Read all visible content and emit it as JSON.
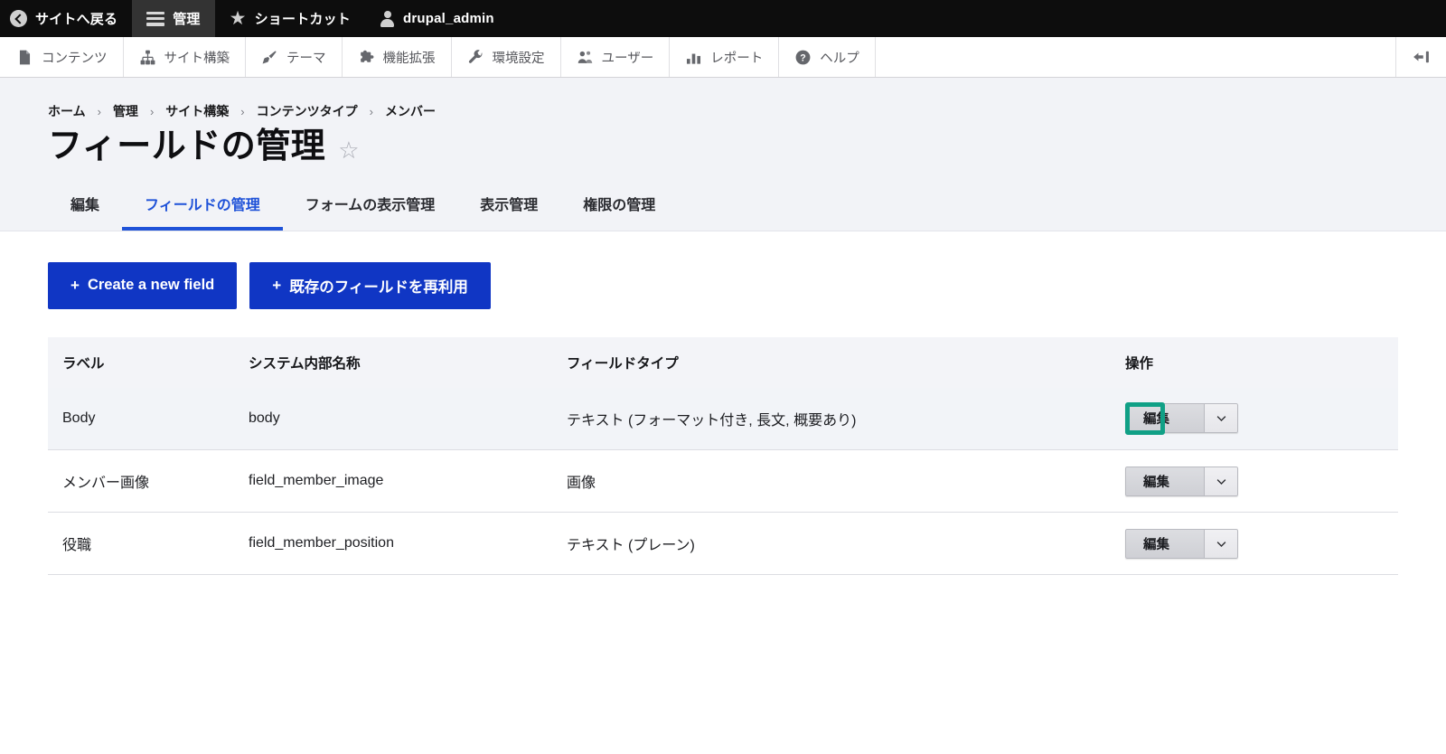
{
  "admin_bar": {
    "items": [
      {
        "label": "サイトへ戻る",
        "icon": "back-circle-icon",
        "active": false
      },
      {
        "label": "管理",
        "icon": "hamburger-menu-icon",
        "active": true
      },
      {
        "label": "ショートカット",
        "icon": "star-icon",
        "active": false
      },
      {
        "label": "drupal_admin",
        "icon": "user-person-icon",
        "active": false
      }
    ]
  },
  "menu_bar": {
    "items": [
      {
        "label": "コンテンツ",
        "icon": "document-icon"
      },
      {
        "label": "サイト構築",
        "icon": "sitemap-icon"
      },
      {
        "label": "テーマ",
        "icon": "paintbrush-icon"
      },
      {
        "label": "機能拡張",
        "icon": "puzzle-piece-icon"
      },
      {
        "label": "環境設定",
        "icon": "wrench-icon"
      },
      {
        "label": "ユーザー",
        "icon": "users-icon"
      },
      {
        "label": "レポート",
        "icon": "bar-chart-icon"
      },
      {
        "label": "ヘルプ",
        "icon": "question-mark-icon"
      }
    ],
    "toggle_icon": "collapse-toolbar-icon"
  },
  "breadcrumb": [
    {
      "label": "ホーム"
    },
    {
      "label": "管理"
    },
    {
      "label": "サイト構築"
    },
    {
      "label": "コンテンツタイプ"
    },
    {
      "label": "メンバー"
    }
  ],
  "breadcrumb_separator": "›",
  "page": {
    "title": "フィールドの管理",
    "favorite_icon": "☆"
  },
  "tabs": [
    {
      "label": "編集",
      "active": false
    },
    {
      "label": "フィールドの管理",
      "active": true
    },
    {
      "label": "フォームの表示管理",
      "active": false
    },
    {
      "label": "表示管理",
      "active": false
    },
    {
      "label": "権限の管理",
      "active": false
    }
  ],
  "actions": [
    {
      "label": "Create a new field",
      "prefix": "+"
    },
    {
      "label": "既存のフィールドを再利用",
      "prefix": "+"
    }
  ],
  "table": {
    "headers": [
      "ラベル",
      "システム内部名称",
      "フィールドタイプ",
      "操作"
    ],
    "rows": [
      {
        "label": "Body",
        "machine_name": "body",
        "field_type": "テキスト (フォーマット付き, 長文, 概要あり)",
        "op_label": "編集",
        "highlighted": true
      },
      {
        "label": "メンバー画像",
        "machine_name": "field_member_image",
        "field_type": "画像",
        "op_label": "編集",
        "highlighted": false
      },
      {
        "label": "役職",
        "machine_name": "field_member_position",
        "field_type": "テキスト (プレーン)",
        "op_label": "編集",
        "highlighted": false
      }
    ]
  },
  "colors": {
    "admin_bar_bg": "#0d0d0d",
    "primary_button": "#1036c4",
    "active_tab": "#1f52d8",
    "highlight_border": "#10a086",
    "header_bg": "#f2f3f7",
    "row_highlight_bg": "#f2f4f8"
  }
}
